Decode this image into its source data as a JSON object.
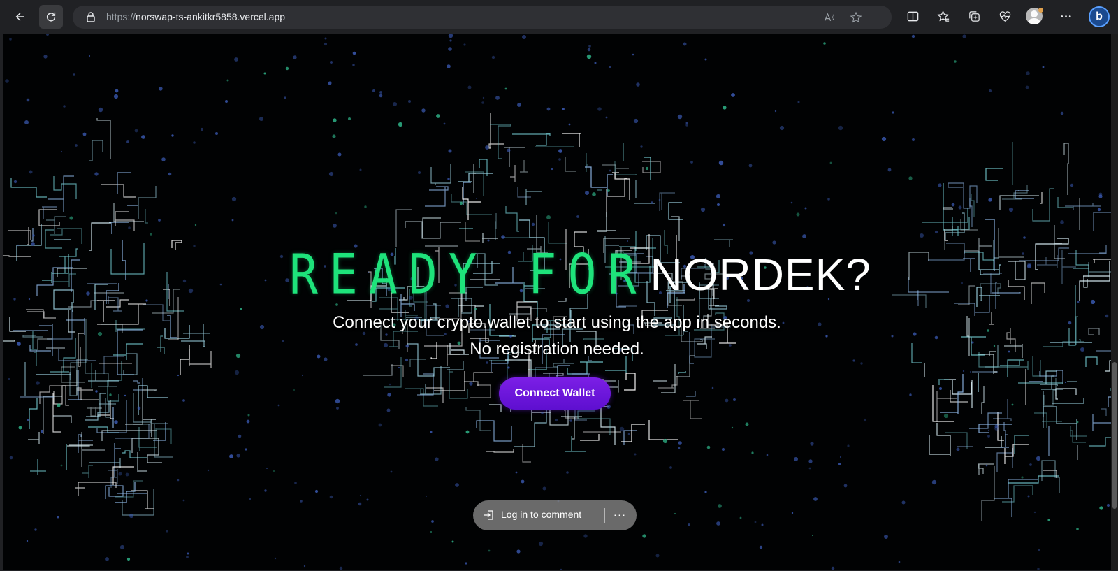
{
  "browser": {
    "url_scheme": "https://",
    "url_host": "norswap-ts-ankitkr5858.vercel.app",
    "icons": [
      "back-icon",
      "refresh-icon",
      "lock-icon",
      "read-aloud-icon",
      "favorite-star-icon",
      "split-screen-icon",
      "favorites-icon",
      "collections-icon",
      "health-icon",
      "profile-avatar",
      "more-icon",
      "copilot-icon"
    ],
    "copilot_label": "b"
  },
  "hero": {
    "headline_digital": "READY FOR",
    "headline_brand": "NORDEK?",
    "subtitle_line1": "Connect your crypto wallet to start using the app in seconds.",
    "subtitle_line2": "No registration needed.",
    "connect_button": "Connect Wallet"
  },
  "comment_bar": {
    "login_label": "Log in to comment",
    "more_label": "···"
  },
  "colors": {
    "accent_green": "#1ee37b",
    "button_purple": "#6a14dc",
    "background": "#010203"
  }
}
